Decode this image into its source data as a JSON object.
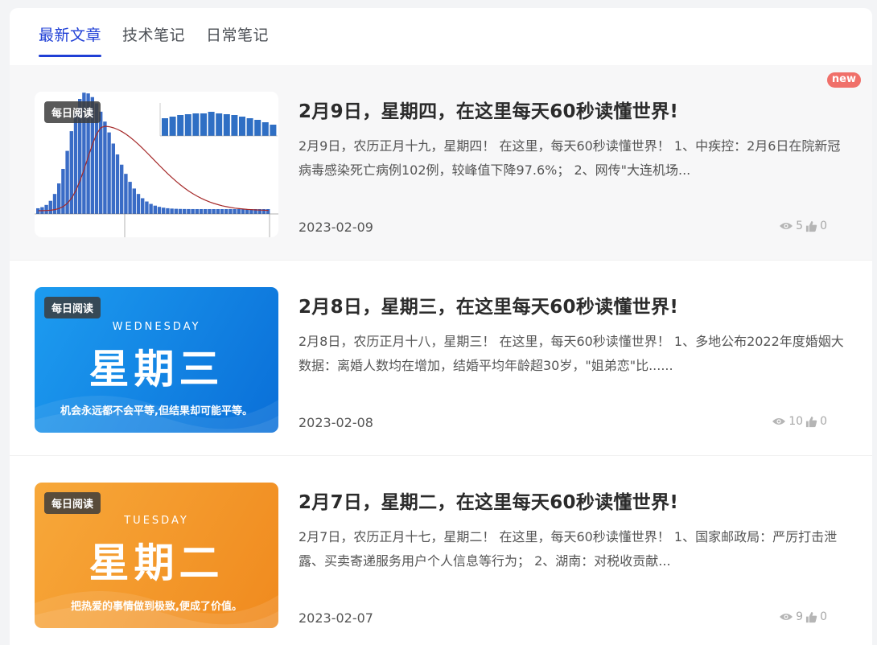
{
  "tabs": [
    {
      "label": "最新文章",
      "active": true
    },
    {
      "label": "技术笔记",
      "active": false
    },
    {
      "label": "日常笔记",
      "active": false
    }
  ],
  "badge_text": "每日阅读",
  "new_badge": "new",
  "posts": [
    {
      "title": "2月9日，星期四，在这里每天60秒读懂世界!",
      "excerpt": "2月9日，农历正月十九，星期四！ 在这里，每天60秒读懂世界！ 1、中疾控：2月6日在院新冠病毒感染死亡病例102例，较峰值下降97.6%； 2、网传\"大连机场...",
      "date": "2023-02-09",
      "views": "5",
      "likes": "0"
    },
    {
      "title": "2月8日，星期三，在这里每天60秒读懂世界!",
      "excerpt": "2月8日，农历正月十八，星期三！ 在这里，每天60秒读懂世界！ 1、多地公布2022年度婚姻大数据：离婚人数均在增加，结婚平均年龄超30岁，\"姐弟恋\"比......",
      "date": "2023-02-08",
      "views": "10",
      "likes": "0",
      "thumb": {
        "en": "WEDNESDAY",
        "cn": "星期三",
        "motto": "机会永远都不会平等,但结果却可能平等。"
      }
    },
    {
      "title": "2月7日，星期二，在这里每天60秒读懂世界!",
      "excerpt": "2月7日，农历正月十七，星期二！ 在这里，每天60秒读懂世界！ 1、国家邮政局：严厉打击泄露、买卖寄递服务用户个人信息等行为； 2、湖南：对税收贡献...",
      "date": "2023-02-07",
      "views": "9",
      "likes": "0",
      "thumb": {
        "en": "TUESDAY",
        "cn": "星期二",
        "motto": "把热爱的事情做到极致,便成了价值。"
      }
    }
  ],
  "colors": {
    "accent": "#1f3fd6",
    "new_badge": "#f0706a",
    "bar": "#3a6cc6",
    "line": "#a52a2a"
  }
}
